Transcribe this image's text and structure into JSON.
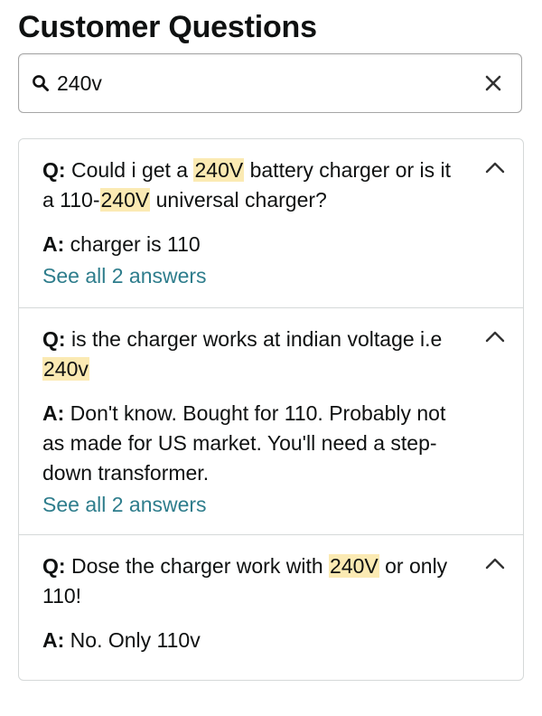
{
  "page_title": "Customer Questions",
  "search": {
    "value": "240v"
  },
  "questions": [
    {
      "q_prefix": "Q:",
      "q_parts": [
        "Could i get a ",
        "240V",
        " battery charger or is it a 110-",
        "240V",
        " universal charger?"
      ],
      "a_prefix": "A:",
      "answer": "charger is 110",
      "see_all": "See all 2 answers"
    },
    {
      "q_prefix": "Q:",
      "q_parts": [
        "is the charger works at indian voltage i.e ",
        "240v"
      ],
      "a_prefix": "A:",
      "answer": "Don't know. Bought for 110. Probably not as made for US market. You'll need a step-down transformer.",
      "see_all": "See all 2 answers"
    },
    {
      "q_prefix": "Q:",
      "q_parts": [
        "Dose the charger work with ",
        "240V",
        " or only 110!"
      ],
      "a_prefix": "A:",
      "answer": "No. Only 110v"
    }
  ],
  "colors": {
    "highlight": "#fbeab3",
    "link": "#2e7d8c",
    "border": "#d5d9d9"
  }
}
